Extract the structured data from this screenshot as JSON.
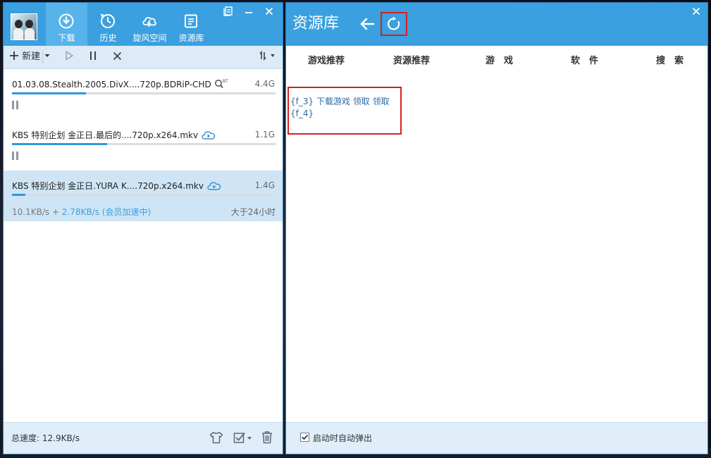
{
  "left_window": {
    "nav_tabs": [
      {
        "label": "下载",
        "icon": "download-icon",
        "active": true
      },
      {
        "label": "历史",
        "icon": "history-clock-icon",
        "active": false
      },
      {
        "label": "旋风空间",
        "icon": "cloud-lightning-icon",
        "active": false
      },
      {
        "label": "资源库",
        "icon": "library-icon",
        "active": false
      }
    ],
    "toolbar": {
      "new_label": "新建",
      "new_icon": "plus-icon"
    },
    "tasks": [
      {
        "name": "01.03.08.Stealth.2005.DivX....720p.BDRiP-CHD",
        "size": "4.4G",
        "progress": 0.28,
        "status": "paused",
        "badge": "bt-search-icon"
      },
      {
        "name": "KBS 特别企划 金正日.最后的....720p.x264.mkv",
        "size": "1.1G",
        "progress": 0.36,
        "status": "paused",
        "badge": "cloud-play-icon"
      },
      {
        "name": "KBS 特别企划 金正日.YURA K....720p.x264.mkv",
        "size": "1.4G",
        "progress": 0.05,
        "status": "downloading",
        "badge": "cloud-play-icon",
        "speed": "10.1KB/s",
        "speed_plus": "+",
        "accel_speed": "2.78KB/s (会员加速中)",
        "time_left": "大于24小时"
      }
    ],
    "footer": {
      "total_speed": "总速度: 12.9KB/s"
    }
  },
  "right_window": {
    "title": "资源库",
    "tabs": [
      "游戏推荐",
      "资源推荐",
      "游　戏",
      "软　件",
      "搜　索"
    ],
    "content_lines": [
      "{f_3} 下载游戏  领取  领取",
      "{f_4}"
    ],
    "footer": {
      "auto_popup_label": "启动时自动弹出",
      "auto_popup_checked": true
    }
  },
  "colors": {
    "header_blue": "#3aa0e0",
    "active_tab_blue": "#57b3ea",
    "progress_blue": "#2e97dd",
    "highlight_red": "#d62020"
  }
}
